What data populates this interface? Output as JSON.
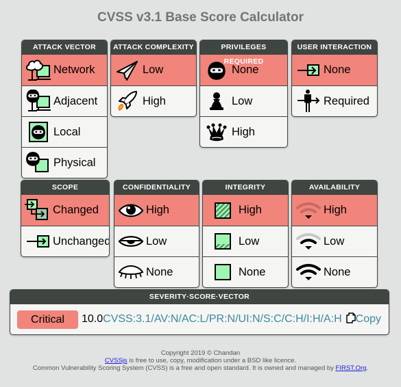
{
  "title": "CVSS v3.1 Base Score Calculator",
  "colors": {
    "selected": "#f1847b",
    "header": "#3f4540",
    "vector": "#3a8aa0",
    "green": "#9ff5b4"
  },
  "metrics": {
    "av": {
      "title": "ATTACK VECTOR",
      "options": [
        {
          "label": "Network",
          "icon": "network-icon",
          "selected": true
        },
        {
          "label": "Adjacent",
          "icon": "adjacent-icon",
          "selected": false
        },
        {
          "label": "Local",
          "icon": "local-icon",
          "selected": false
        },
        {
          "label": "Physical",
          "icon": "physical-icon",
          "selected": false
        }
      ]
    },
    "ac": {
      "title": "ATTACK COMPLEXITY",
      "options": [
        {
          "label": "Low",
          "icon": "paper-plane-icon",
          "selected": true
        },
        {
          "label": "High",
          "icon": "rocket-icon",
          "selected": false
        }
      ]
    },
    "pr": {
      "title": "PRIVILEGES REQUIRED",
      "options": [
        {
          "label": "None",
          "icon": "ninja-icon",
          "selected": true
        },
        {
          "label": "Low",
          "icon": "pawn-icon",
          "selected": false
        },
        {
          "label": "High",
          "icon": "queen-icon",
          "selected": false
        }
      ]
    },
    "ui": {
      "title": "USER INTERACTION",
      "options": [
        {
          "label": "None",
          "icon": "enter-arrow-icon",
          "selected": true
        },
        {
          "label": "Required",
          "icon": "person-arrow-icon",
          "selected": false
        }
      ]
    },
    "s": {
      "title": "SCOPE",
      "options": [
        {
          "label": "Changed",
          "icon": "scope-changed-icon",
          "selected": true
        },
        {
          "label": "Unchanged",
          "icon": "scope-unchanged-icon",
          "selected": false
        }
      ]
    },
    "c": {
      "title": "CONFIDENTIALITY",
      "options": [
        {
          "label": "High",
          "icon": "eye-open-icon",
          "selected": true
        },
        {
          "label": "Low",
          "icon": "eye-half-icon",
          "selected": false
        },
        {
          "label": "None",
          "icon": "eye-closed-icon",
          "selected": false
        }
      ]
    },
    "i": {
      "title": "INTEGRITY",
      "options": [
        {
          "label": "High",
          "icon": "integrity-high-icon",
          "selected": true
        },
        {
          "label": "Low",
          "icon": "integrity-low-icon",
          "selected": false
        },
        {
          "label": "None",
          "icon": "integrity-none-icon",
          "selected": false
        }
      ]
    },
    "a": {
      "title": "AVAILABILITY",
      "options": [
        {
          "label": "High",
          "icon": "wifi-high-icon",
          "selected": true
        },
        {
          "label": "Low",
          "icon": "wifi-low-icon",
          "selected": false
        },
        {
          "label": "None",
          "icon": "wifi-none-icon",
          "selected": false
        }
      ]
    }
  },
  "result": {
    "title": "SEVERITY·SCORE·VECTOR",
    "severity": "Critical",
    "score": "10.0",
    "vector": "CVSS:3.1/AV:N/AC:L/PR:N/UI:N/S:C/C:H/I:H/A:H",
    "copy_label": "Copy"
  },
  "footer": {
    "line1": "Copyright 2019 © Chandan",
    "cvssjs_link": "CVSSjs",
    "line2_rest": " is free to use, copy, modification under a BSD like licence.",
    "line3_pre": "Common Vulnerability Scoring System (CVSS) is a free and open standard. It is owned and managed by ",
    "first_link": "FIRST.Org",
    "line3_post": "."
  }
}
